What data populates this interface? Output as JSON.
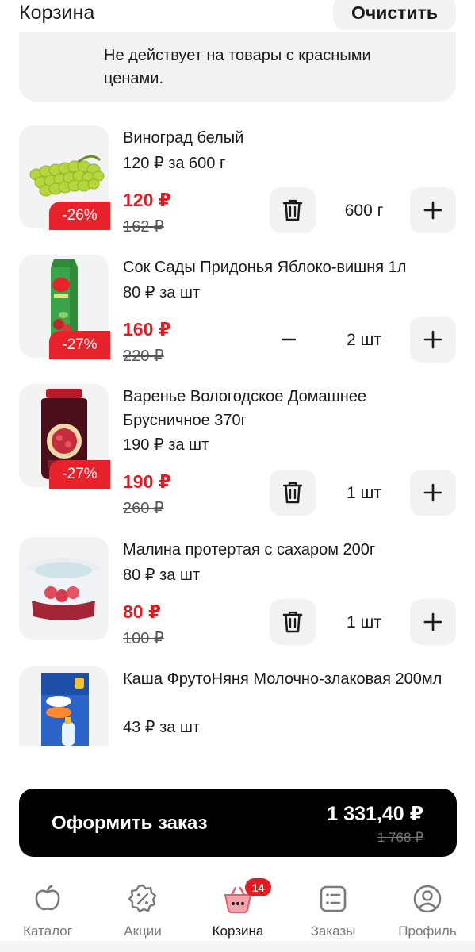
{
  "header": {
    "title": "Корзина",
    "clear_label": "Очистить"
  },
  "notice": {
    "text": "Не действует на товары с красными ценами."
  },
  "items": [
    {
      "name": "Виноград белый",
      "unit_price": "120 ₽ за 600 г",
      "price": "120 ₽",
      "old_price": "162 ₽",
      "discount": "-26%",
      "quantity": "600 г",
      "icon": "grapes-image"
    },
    {
      "name": "Сок Сады Придонья Яблоко-вишня 1л",
      "unit_price": "80 ₽ за шт",
      "price": "160 ₽",
      "old_price": "220 ₽",
      "discount": "-27%",
      "quantity": "2 шт",
      "icon": "juice-carton-image"
    },
    {
      "name": "Варенье Вологодское Домашнее Брусничное 370г",
      "unit_price": "190 ₽ за шт",
      "price": "190 ₽",
      "old_price": "260 ₽",
      "discount": "-27%",
      "quantity": "1 шт",
      "icon": "jam-jar-image"
    },
    {
      "name": "Малина протертая с сахаром 200г",
      "unit_price": "80 ₽ за шт",
      "price": "80 ₽",
      "old_price": "100 ₽",
      "quantity": "1 шт",
      "icon": "raspberry-cup-image"
    },
    {
      "name": "Каша ФрутоНяня Молочно-злаковая 200мл",
      "unit_price": "43 ₽ за шт",
      "icon": "porridge-carton-image"
    }
  ],
  "checkout": {
    "label": "Оформить заказ",
    "total": "1 331,40 ₽",
    "old_total": "1 768 ₽"
  },
  "tabbar": {
    "tabs": [
      {
        "label": "Каталог",
        "icon": "apple-icon"
      },
      {
        "label": "Акции",
        "icon": "discount-icon"
      },
      {
        "label": "Корзина",
        "icon": "basket-icon",
        "badge": "14",
        "active": true
      },
      {
        "label": "Заказы",
        "icon": "orders-list-icon"
      },
      {
        "label": "Профиль",
        "icon": "profile-icon"
      }
    ]
  },
  "colors": {
    "accent": "#e21b23",
    "button_bg": "#f2f2f2",
    "checkout_bg": "#000000"
  }
}
